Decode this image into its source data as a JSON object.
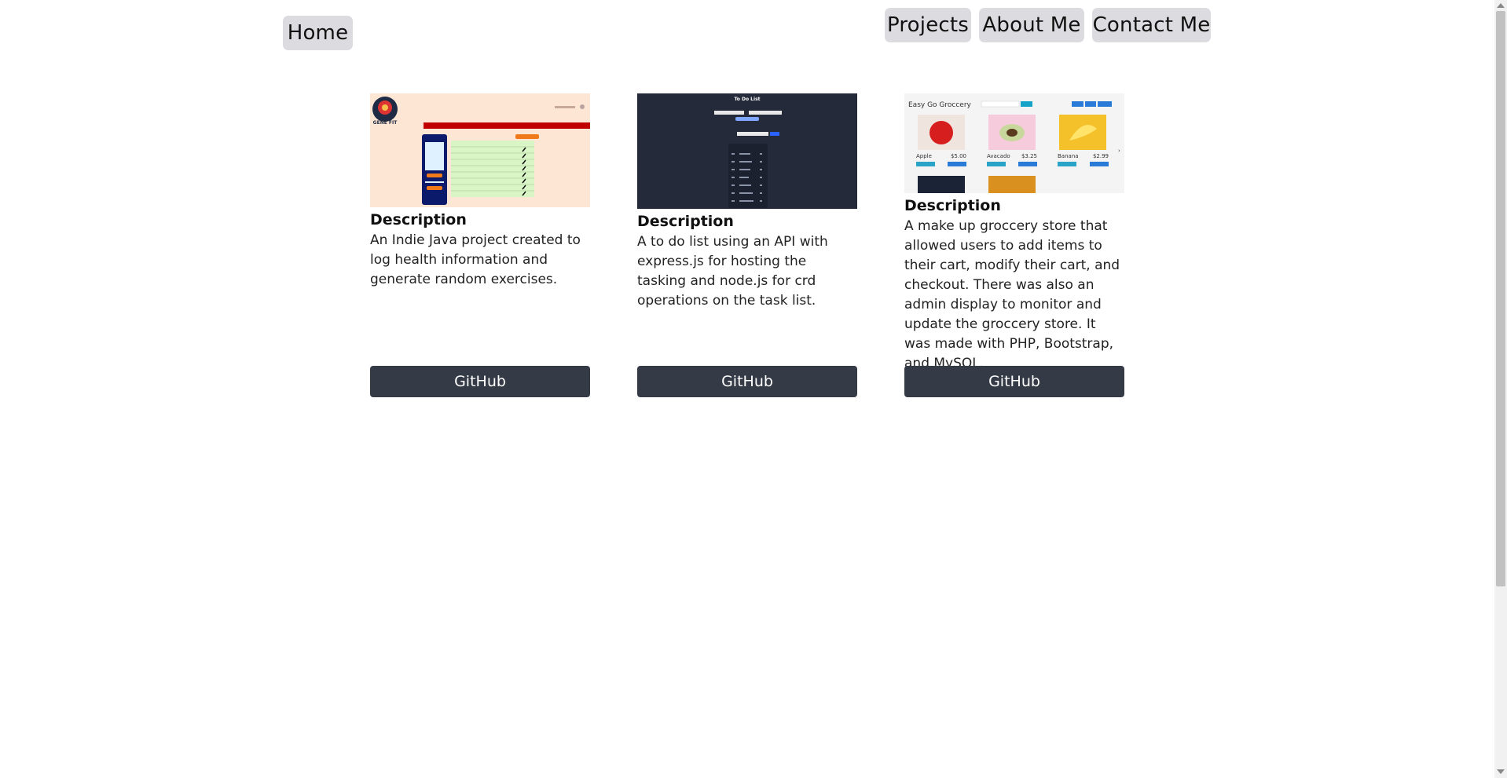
{
  "nav": {
    "home": "Home",
    "projects": "Projects",
    "about": "About Me",
    "contact": "Contact Me"
  },
  "projects": [
    {
      "heading": "Description",
      "text": "An Indie Java project created to log health information and generate random exercises.",
      "button": "GitHub",
      "thumb": {
        "logo_text": "GENE FIT",
        "accent": "#c00000"
      }
    },
    {
      "heading": "Description",
      "text": "A to do list using an API with express.js for hosting the tasking and node.js for crd operations on the task list.",
      "button": "GitHub",
      "thumb": {
        "title": "To Do List",
        "accent": "#242a3a"
      }
    },
    {
      "heading": "Description",
      "text": "A make up groccery store that allowed users to add items to their cart, modify their cart, and checkout. There was also an admin display to monitor and update the groccery store. It was made with PHP, Bootstrap, and MySQL.",
      "button": "GitHub",
      "thumb": {
        "title": "Easy Go Groccery",
        "items": [
          {
            "name": "Apple",
            "price": "$5.00"
          },
          {
            "name": "Avacado",
            "price": "$3.25"
          },
          {
            "name": "Banana",
            "price": "$2.99"
          }
        ]
      }
    }
  ]
}
